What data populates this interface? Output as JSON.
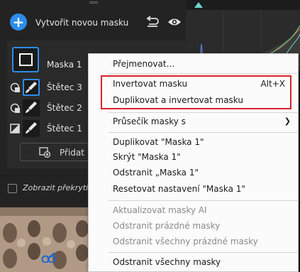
{
  "panel": {
    "create_label": "Vytvořit novou masku",
    "undo_icon": "reset-icon",
    "visibility_icon": "eye-icon",
    "masks": [
      {
        "name": "Maska 1",
        "icon": "mask-thumbnail-icon"
      }
    ],
    "components": [
      {
        "name": "Štětec 3",
        "mode_icon": "subtract-mode-icon",
        "selected": true
      },
      {
        "name": "Štětec 2",
        "mode_icon": "subtract-mode-icon",
        "selected": false
      },
      {
        "name": "Štětec 1",
        "mode_icon": "add-mode-icon",
        "selected": false
      }
    ],
    "add_label": "Přidat",
    "overlay_label": "Zobrazit překrytí (a",
    "overlay_checked": false
  },
  "context_menu": {
    "items": [
      {
        "label": "Přejmenovat..."
      },
      {
        "label": "Invertovat masku",
        "shortcut": "Alt+X"
      },
      {
        "label": "Duplikovat a invertovat masku"
      },
      {
        "label": "Průsečík masky s",
        "submenu": true
      },
      {
        "label": "Duplikovat \"Maska 1\""
      },
      {
        "label": "Skrýt \"Maska 1\""
      },
      {
        "label": "Odstranit „Maska 1\""
      },
      {
        "label": "Resetovat nastavení \"Maska 1\""
      },
      {
        "label": "Aktualizovat masky AI",
        "disabled": true
      },
      {
        "label": "Odstranit prázdné masky",
        "disabled": true
      },
      {
        "label": "Odstranit všechny prázdné masky",
        "disabled": true
      },
      {
        "label": "Odstranit všechny masky"
      }
    ],
    "highlight_color": "#d9232d"
  },
  "colors": {
    "accent": "#2d8ceb",
    "panel_bg": "#232323",
    "menu_bg": "#fbfbfb"
  }
}
